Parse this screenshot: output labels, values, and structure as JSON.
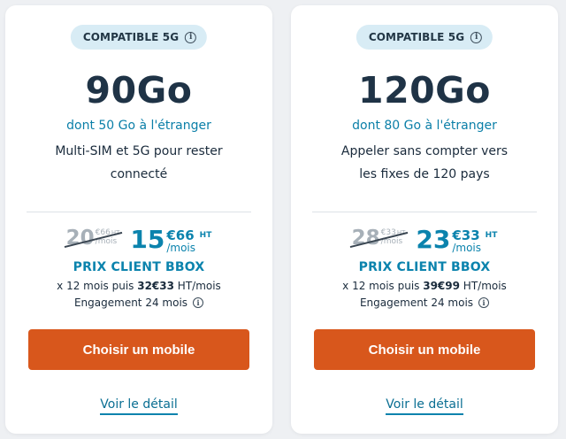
{
  "plans": [
    {
      "badge": "COMPATIBLE 5G",
      "data": "90Go",
      "abroad": "dont 50 Go à l'étranger",
      "feature": "Multi-SIM et 5G pour rester connecté",
      "old_price": {
        "int": "20",
        "cents": "€66",
        "ht": "HT",
        "per": "/mois"
      },
      "new_price": {
        "int": "15",
        "cents": "€66",
        "ht": "HT",
        "per": "/mois"
      },
      "client_label": "PRIX CLIENT BBOX",
      "duration_prefix": "x 12 mois puis ",
      "duration_after_price": "32€33",
      "duration_suffix": " HT/mois",
      "engagement": "Engagement 24 mois",
      "cta": "Choisir un mobile",
      "detail": "Voir le détail"
    },
    {
      "badge": "COMPATIBLE 5G",
      "data": "120Go",
      "abroad": "dont 80 Go à l'étranger",
      "feature": "Appeler sans compter vers les fixes de 120 pays",
      "old_price": {
        "int": "28",
        "cents": "€33",
        "ht": "HT",
        "per": "/mois"
      },
      "new_price": {
        "int": "23",
        "cents": "€33",
        "ht": "HT",
        "per": "/mois"
      },
      "client_label": "PRIX CLIENT BBOX",
      "duration_prefix": "x 12 mois puis ",
      "duration_after_price": "39€99",
      "duration_suffix": " HT/mois",
      "engagement": "Engagement 24 mois",
      "cta": "Choisir un mobile",
      "detail": "Voir le détail"
    }
  ],
  "icons": {
    "info": "info-circle-icon"
  },
  "colors": {
    "accent_blue": "#0b83ad",
    "cta_orange": "#d8571c",
    "badge_bg": "#d8ecf5",
    "heading": "#1f3346"
  }
}
